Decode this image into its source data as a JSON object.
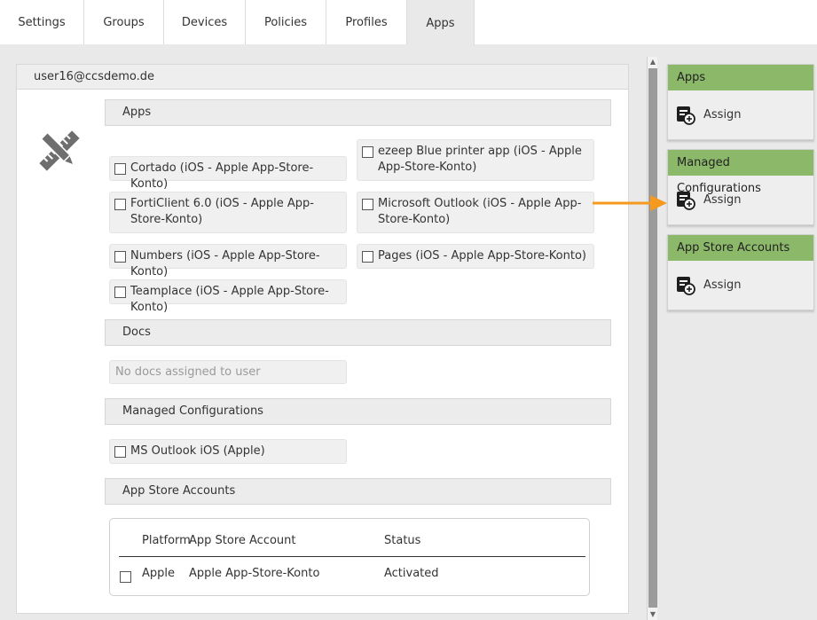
{
  "tabs": [
    {
      "label": "Settings"
    },
    {
      "label": "Groups"
    },
    {
      "label": "Devices"
    },
    {
      "label": "Policies"
    },
    {
      "label": "Profiles"
    },
    {
      "label": "Apps",
      "active": true
    }
  ],
  "user": {
    "email": "user16@ccsdemo.de"
  },
  "sections": {
    "apps": {
      "title": "Apps",
      "items": [
        {
          "label": "Cortado (iOS - Apple App-Store-Konto)"
        },
        {
          "label": "ezeep Blue printer app (iOS - Apple App-Store-Konto)"
        },
        {
          "label": "FortiClient 6.0 (iOS - Apple App-Store-Konto)"
        },
        {
          "label": "Microsoft Outlook (iOS - Apple App-Store-Konto)"
        },
        {
          "label": "Numbers (iOS - Apple App-Store-Konto)"
        },
        {
          "label": "Pages (iOS - Apple App-Store-Konto)"
        },
        {
          "label": "Teamplace (iOS - Apple App-Store-Konto)"
        }
      ]
    },
    "docs": {
      "title": "Docs",
      "empty_text": "No docs assigned to user"
    },
    "managed_configurations": {
      "title": "Managed Configurations",
      "items": [
        {
          "label": "MS Outlook iOS (Apple)"
        }
      ]
    },
    "app_store_accounts": {
      "title": "App Store Accounts",
      "columns": [
        "Platform",
        "App Store Account",
        "Status"
      ],
      "rows": [
        {
          "platform": "Apple",
          "account": "Apple App-Store-Konto",
          "status": "Activated"
        }
      ]
    }
  },
  "side_panels": [
    {
      "title": "Apps",
      "action": "Assign"
    },
    {
      "title": "Managed Configurations",
      "action": "Assign"
    },
    {
      "title": "App Store Accounts",
      "action": "Assign"
    }
  ],
  "colors": {
    "panel_header": "#8cb86a",
    "arrow": "#f59a1f"
  },
  "icons": {
    "tool": "pencil-ruler-icon",
    "assign": "assign-plus-icon"
  }
}
